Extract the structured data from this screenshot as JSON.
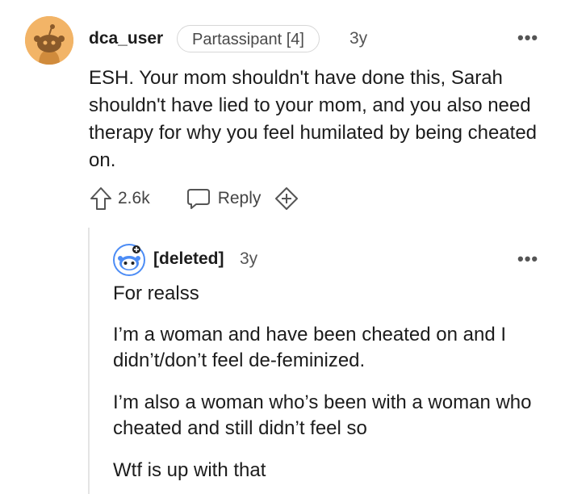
{
  "comment": {
    "username": "dca_user",
    "flair": "Partassipant [4]",
    "age": "3y",
    "more_label": "•••",
    "body": "ESH. Your mom shouldn't have done this, Sarah shouldn't have lied to your mom, and you also need therapy for why you feel humilated by being cheated on.",
    "upvote_count": "2.6k",
    "reply_label": "Reply",
    "icons": {
      "avatar": "snoo-avatar-icon",
      "upvote": "upvote-arrow-icon",
      "reply": "speech-bubble-icon",
      "award": "award-plus-icon"
    }
  },
  "reply": {
    "username": "[deleted]",
    "age": "3y",
    "more_label": "•••",
    "paragraphs": [
      "For realss",
      "I’m a woman and have been cheated on and I didn’t/don’t feel de-feminized.",
      "I’m also a woman who’s been with a woman who cheated and still didn’t feel so",
      "Wtf is up with that"
    ]
  },
  "colors": {
    "avatar_bg": "#f2b467",
    "text": "#1c1c1c",
    "muted": "#555555",
    "border": "#d7d7d7",
    "deleted_avatar": "#4c8cf5"
  }
}
